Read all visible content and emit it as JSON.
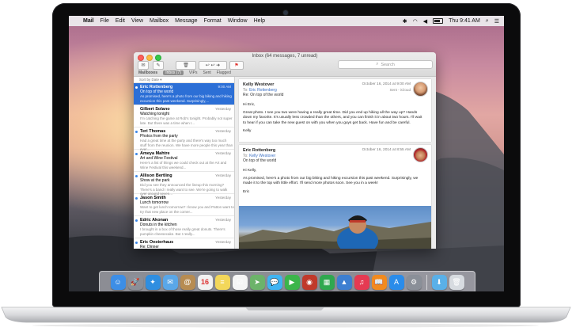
{
  "menubar": {
    "app": "Mail",
    "items": [
      "File",
      "Edit",
      "View",
      "Mailbox",
      "Message",
      "Format",
      "Window",
      "Help"
    ],
    "clock": "Thu 9:41 AM"
  },
  "window": {
    "title": "Inbox (64 messages, 7 unread)",
    "search_placeholder": "Search",
    "favorites": {
      "mailboxes": "Mailboxes",
      "inbox": "Inbox (7)",
      "vips": "VIPs",
      "sent": "Sent",
      "flagged": "Flagged"
    },
    "sort_label": "Sort by Date ▾"
  },
  "messages": [
    {
      "from": "Eric Rottenberg",
      "date": "9:00 AM",
      "subject": "On top of the world",
      "preview": "As promised, here's a photo from our big biking and hiking excursion this past weekend. Surprisingly,...",
      "unread": true,
      "selected": true
    },
    {
      "from": "Gilbert Solano",
      "date": "Yesterday",
      "subject": "Watching tonight",
      "preview": "I'm catching the game at Rob's tonight. Probably not super late. But there was a time when I...",
      "unread": false,
      "selected": false
    },
    {
      "from": "Teri Thomas",
      "date": "Yesterday",
      "subject": "Photos from the party",
      "preview": "Had a great time at the party and there's way too much stuff from the reunion. We have more people this year than ever...",
      "unread": true,
      "selected": false
    },
    {
      "from": "Ameya Mahtre",
      "date": "Yesterday",
      "subject": "Art and Wine Festival",
      "preview": "Here's a list of things we could check out at the Art and Wine Festival this weekend...",
      "unread": true,
      "selected": false
    },
    {
      "from": "Allison Bertling",
      "date": "Yesterday",
      "subject": "Show at the park",
      "preview": "Did you see they announced the lineup this morning? There's a band I really want to see. We're going to walk over around seven...",
      "unread": true,
      "selected": false
    },
    {
      "from": "Jason Smith",
      "date": "Yesterday",
      "subject": "Lunch tomorrow",
      "preview": "Want to get lunch tomorrow? I know you and Patton want to try that new place on the corner...",
      "unread": true,
      "selected": false
    },
    {
      "from": "Edric Akonan",
      "date": "Yesterday",
      "subject": "Donuts in the kitchen",
      "preview": "I brought in a box of those really great donuts. There's pumpkin cheesecake. But I really...",
      "unread": true,
      "selected": false
    },
    {
      "from": "Eric Oesterhaus",
      "date": "Yesterday",
      "subject": "Re: Dinner",
      "preview": "",
      "unread": true,
      "selected": false
    }
  ],
  "reading": {
    "reply": {
      "from": "Kelly Westover",
      "to_label": "To:",
      "to": "Eric Rottenberg",
      "subject": "Re: On top of the world",
      "date": "October 16, 2014 at 9:00 AM",
      "meta": "Sent - iCloud",
      "body": [
        "Hi Eric,",
        "Great photo. I see you two were having a really great time. Did you end up hiking all the way up? Hands down my favorite. It's usually less crowded than the others, and you can finish it in about two hours. I'll wait to hear if you can take the new guest on with you when you guys get back. Have fun and be careful.",
        "Kelly"
      ]
    },
    "original": {
      "from": "Eric Rottenberg",
      "to_label": "To:",
      "to": "Kelly Westover",
      "subject": "On top of the world",
      "date": "October 16, 2014 at 8:55 AM",
      "body": [
        "Hi Kelly,",
        "As promised, here's a photo from our big biking and hiking excursion this past weekend. Surprisingly, we made it to the top with little effort. I'll send more photos soon. See you in a week!",
        "Eric"
      ]
    }
  },
  "dock": {
    "calendar_day": "16",
    "icons": [
      {
        "name": "finder-icon",
        "color": "#3d8ee6",
        "glyph": "☺"
      },
      {
        "name": "launchpad-icon",
        "color": "#8b8f98",
        "glyph": "🚀"
      },
      {
        "name": "safari-icon",
        "color": "#2f8ee0",
        "glyph": "✦"
      },
      {
        "name": "mail-icon",
        "color": "#5aa7e8",
        "glyph": "✉"
      },
      {
        "name": "contacts-icon",
        "color": "#b78c52",
        "glyph": "@"
      },
      {
        "name": "calendar-icon",
        "color": "#f2f2f2",
        "glyph": "16"
      },
      {
        "name": "notes-icon",
        "color": "#f3d75a",
        "glyph": "≡"
      },
      {
        "name": "reminders-icon",
        "color": "#f5f5f5",
        "glyph": "☑"
      },
      {
        "name": "maps-icon",
        "color": "#6cb36a",
        "glyph": "➤"
      },
      {
        "name": "messages-icon",
        "color": "#3fb4f2",
        "glyph": "💬"
      },
      {
        "name": "facetime-icon",
        "color": "#3bb54a",
        "glyph": "▶"
      },
      {
        "name": "photo-booth-icon",
        "color": "#c0392b",
        "glyph": "◉"
      },
      {
        "name": "numbers-icon",
        "color": "#2fa84f",
        "glyph": "▦"
      },
      {
        "name": "keynote-icon",
        "color": "#3d7fd1",
        "glyph": "▲"
      },
      {
        "name": "itunes-icon",
        "color": "#e53a52",
        "glyph": "♫"
      },
      {
        "name": "ibooks-icon",
        "color": "#f28a1e",
        "glyph": "📖"
      },
      {
        "name": "app-store-icon",
        "color": "#2a8cea",
        "glyph": "A"
      },
      {
        "name": "system-preferences-icon",
        "color": "#8a8f98",
        "glyph": "⚙"
      },
      {
        "name": "downloads-folder-icon",
        "color": "#5ab0e8",
        "glyph": "⬇"
      },
      {
        "name": "trash-icon",
        "color": "#d7dbe0",
        "glyph": "🗑"
      }
    ]
  }
}
